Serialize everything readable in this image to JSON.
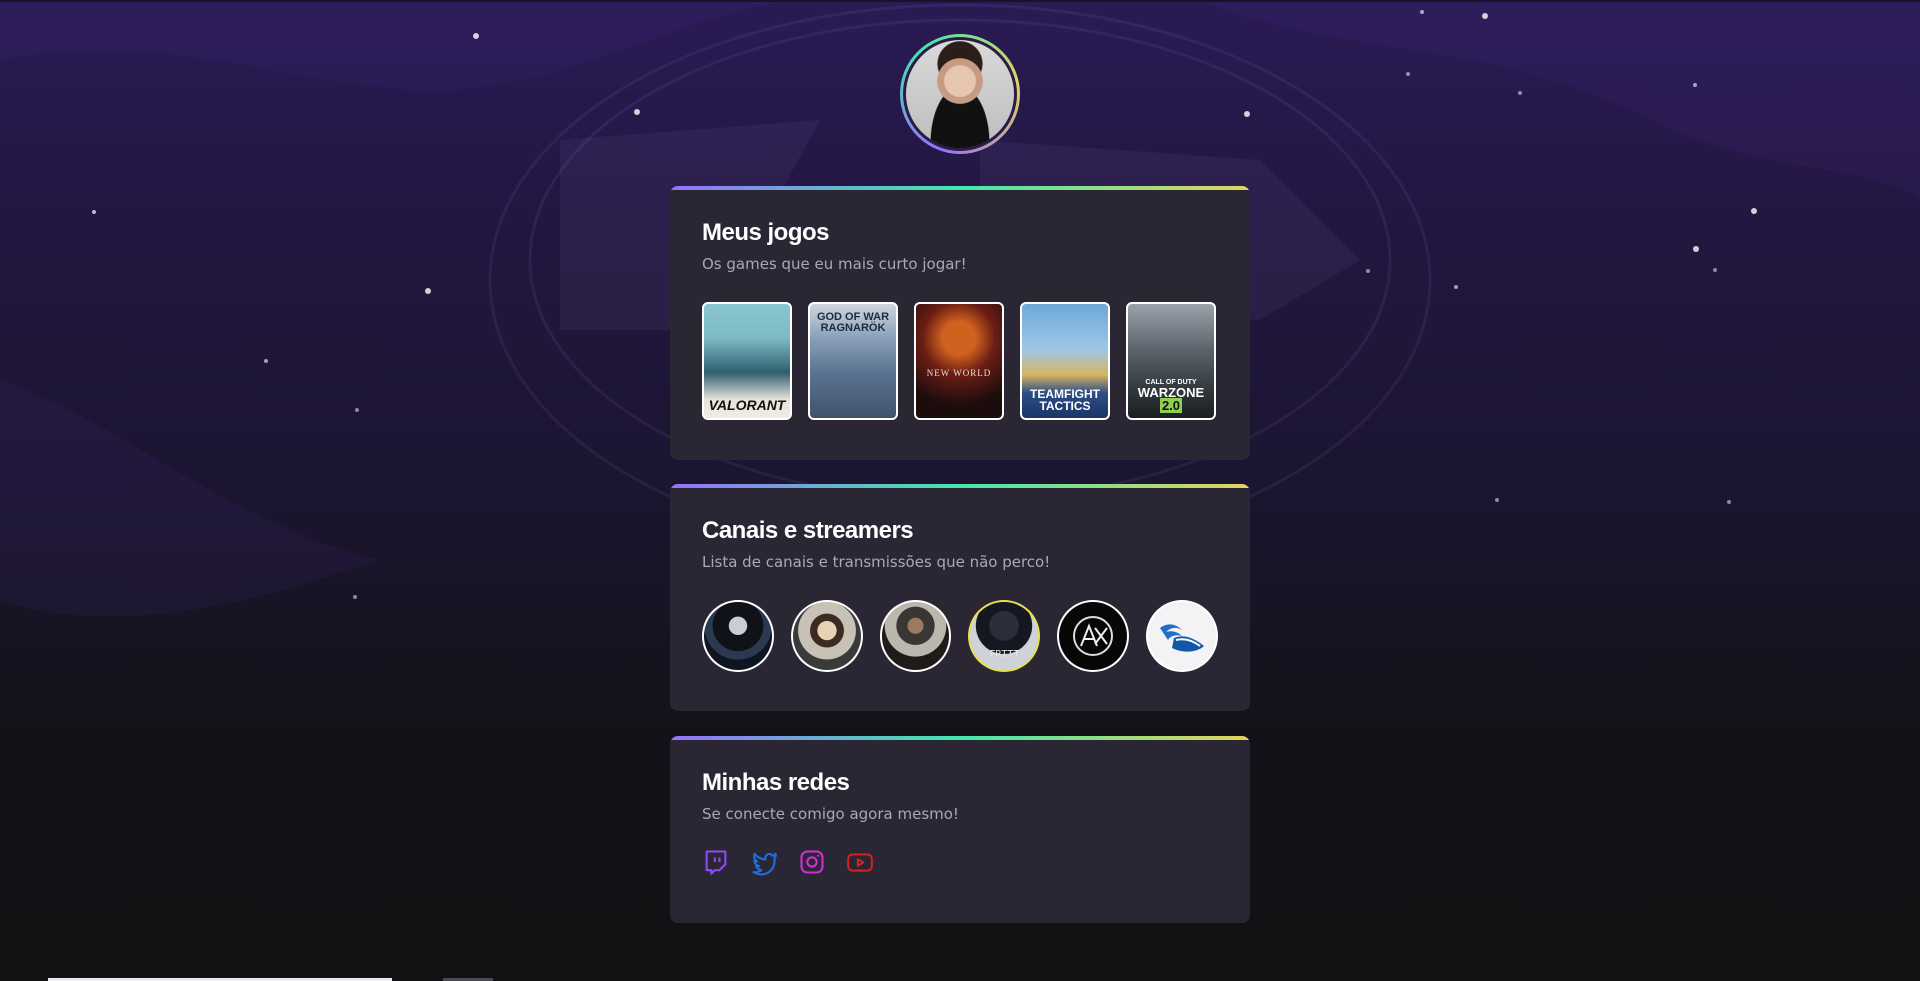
{
  "profile": {
    "avatar_alt": "Foto de perfil"
  },
  "games_section": {
    "title": "Meus jogos",
    "subtitle": "Os games que eu mais curto jogar!",
    "games": [
      {
        "label": "VALORANT"
      },
      {
        "label": "GOD OF WAR RAGNARÖK"
      },
      {
        "label": "NEW WORLD"
      },
      {
        "label": "TEAMFIGHT TACTICS"
      },
      {
        "label": "WARZONE",
        "badge": "2.0",
        "prefix": "CALL OF DUTY"
      }
    ]
  },
  "channels_section": {
    "title": "Canais e streamers",
    "subtitle": "Lista de canais e transmissões que não perco!",
    "channels": [
      {
        "icon": "avatar-dark-hair"
      },
      {
        "icon": "avatar-cowboy"
      },
      {
        "icon": "avatar-soldier"
      },
      {
        "icon": "avatar-hood",
        "label": "FRTTT"
      },
      {
        "icon": "logo-ax"
      },
      {
        "icon": "logo-winged-shoe"
      }
    ]
  },
  "social_section": {
    "title": "Minhas redes",
    "subtitle": "Se conecte comigo agora mesmo!",
    "links": [
      {
        "icon": "twitch-icon",
        "color": "#9147ff"
      },
      {
        "icon": "twitter-icon",
        "color": "#1d6fe0"
      },
      {
        "icon": "instagram-icon",
        "color": "#d12ed6"
      },
      {
        "icon": "youtube-icon",
        "color": "#e02020"
      }
    ]
  },
  "colors": {
    "gradient_start": "#9572fc",
    "gradient_mid": "#43e7ad",
    "gradient_end": "#e2d45c",
    "card_bg": "#2a2634"
  }
}
